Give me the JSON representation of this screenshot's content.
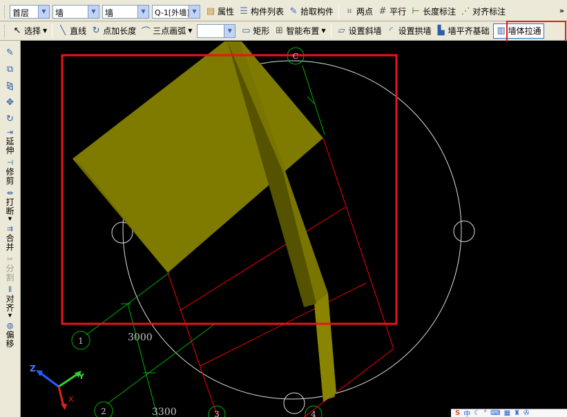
{
  "toolbar1": {
    "floor": "首层",
    "type1": "墙",
    "type2": "墙",
    "component": "Q-1[外墙]",
    "properties": "属性",
    "component_list": "构件列表",
    "pick": "拾取构件",
    "two_points": "两点",
    "parallel": "平行",
    "length_dim": "长度标注",
    "align_dim": "对齐标注",
    "more": "»"
  },
  "toolbar2": {
    "select": "选择",
    "line": "直线",
    "point_length": "点加长度",
    "three_arc": "三点画弧",
    "empty_combo": "",
    "rect": "矩形",
    "smart_layout": "智能布置",
    "slant_wall": "设置斜墙",
    "arch_wall": "设置拱墙",
    "flush_base": "墙平齐基础",
    "pull_through": "墙体拉通"
  },
  "sidebar": {
    "extend": "延伸",
    "trim": "修剪",
    "break": "打断",
    "merge": "合并",
    "split": "分割",
    "align": "对齐",
    "offset": "偏移"
  },
  "canvas": {
    "axis_c": "C",
    "axis_1": "1",
    "axis_2": "2",
    "axis_3": "3",
    "axis_4": "4",
    "dim_3000": "3000",
    "dim_3300": "3300",
    "axis_x": "X",
    "axis_y": "Y",
    "axis_z": "Z"
  },
  "tray": {
    "ime": "中"
  },
  "colors": {
    "wall_face": "#7F7A00",
    "wall_side": "#5F5C00",
    "red_line": "#FF0000",
    "green_axis": "#00B400",
    "highlight": "#E8141C"
  }
}
